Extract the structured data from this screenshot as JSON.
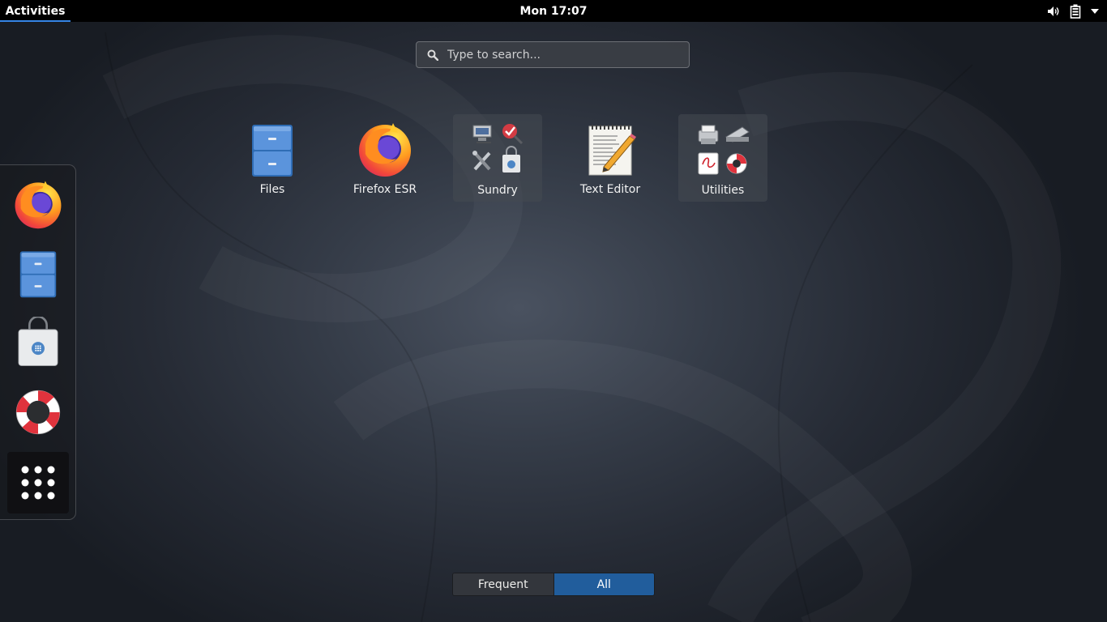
{
  "topbar": {
    "activities": "Activities",
    "clock": "Mon 17:07",
    "tray_icons": [
      "volume-icon",
      "battery-icon",
      "menu-arrow-icon"
    ]
  },
  "search": {
    "placeholder": "Type to search..."
  },
  "apps": [
    {
      "label": "Files",
      "icon": "file-cabinet-icon"
    },
    {
      "label": "Firefox ESR",
      "icon": "firefox-icon"
    },
    {
      "label": "Sundry",
      "icon": "folder-sundry-icon"
    },
    {
      "label": "Text Editor",
      "icon": "notepad-pencil-icon"
    },
    {
      "label": "Utilities",
      "icon": "folder-utilities-icon"
    }
  ],
  "dash": {
    "items": [
      "firefox-icon",
      "file-cabinet-icon",
      "software-bag-icon",
      "lifebuoy-icon",
      "show-apps-grid-icon"
    ]
  },
  "switcher": {
    "frequent": "Frequent",
    "all": "All",
    "selected": "All"
  },
  "colors": {
    "accent": "#3584e4",
    "selected_tab": "#215d9c",
    "topbar": "#000000"
  }
}
